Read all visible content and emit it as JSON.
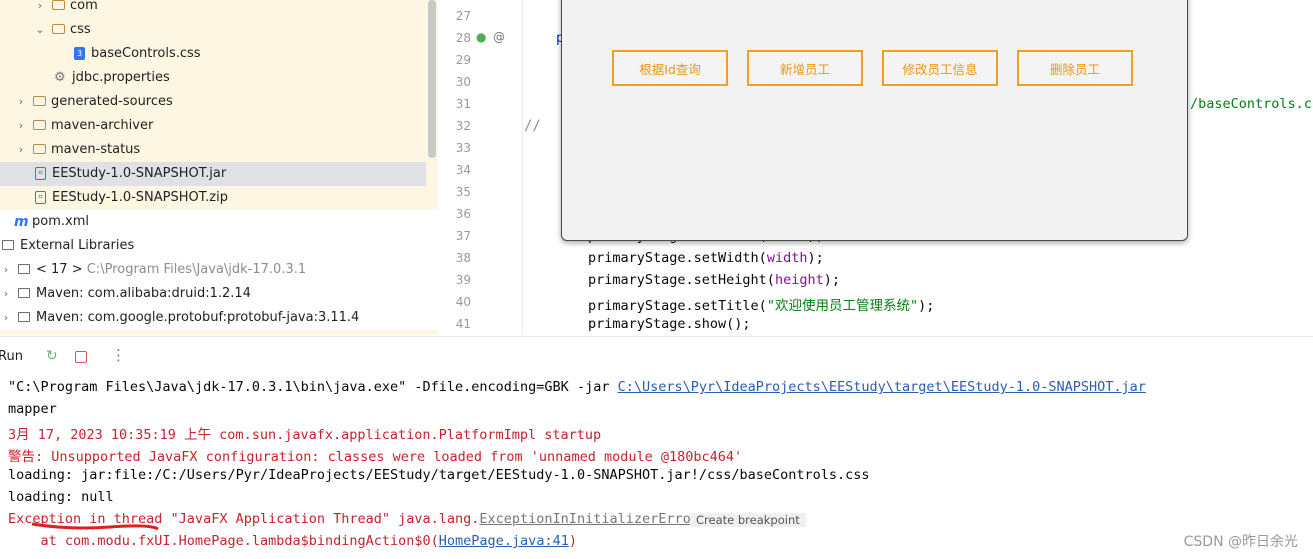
{
  "tree": {
    "items": [
      {
        "label": "com",
        "kind": "folder",
        "chev": "›"
      },
      {
        "label": "css",
        "kind": "folder",
        "chev": "⌄"
      },
      {
        "label": "baseControls.css",
        "kind": "css"
      },
      {
        "label": "jdbc.properties",
        "kind": "gear"
      },
      {
        "label": "generated-sources",
        "kind": "folder",
        "chev": "›"
      },
      {
        "label": "maven-archiver",
        "kind": "folder",
        "chev": "›"
      },
      {
        "label": "maven-status",
        "kind": "folder",
        "chev": "›"
      },
      {
        "label": "EEStudy-1.0-SNAPSHOT.jar",
        "kind": "archive"
      },
      {
        "label": "EEStudy-1.0-SNAPSHOT.zip",
        "kind": "archive"
      },
      {
        "label": "pom.xml",
        "kind": "maven"
      },
      {
        "label": "External Libraries",
        "kind": "lib"
      },
      {
        "label": "< 17 >",
        "extra": "C:\\Program Files\\Java\\jdk-17.0.3.1",
        "kind": "lib"
      },
      {
        "label": "Maven: com.alibaba:druid:1.2.14",
        "kind": "lib"
      },
      {
        "label": "Maven: com.google.protobuf:protobuf-java:3.11.4",
        "kind": "lib"
      }
    ]
  },
  "editor": {
    "line_numbers": [
      "27",
      "28",
      "29",
      "30",
      "31",
      "32",
      "33",
      "34",
      "35",
      "36",
      "37",
      "38",
      "39",
      "40",
      "41"
    ],
    "comment": "//",
    "left_fragment": "p",
    "path_fragment": "/baseControls.cs",
    "code": [
      {
        "pre": "primaryStage.setScene(",
        "arg": "scene",
        "post": ");"
      },
      {
        "pre": "primaryStage.setWidth(",
        "arg": "width",
        "post": ");"
      },
      {
        "pre": "primaryStage.setHeight(",
        "arg": "height",
        "post": ");"
      },
      {
        "pre": "primaryStage.setTitle(",
        "str": "\"欢迎使用员工管理系统\"",
        "post": ");"
      },
      {
        "pre": "primaryStage.show();"
      }
    ]
  },
  "fx_window": {
    "buttons": [
      "根据Id查询",
      "新增员工",
      "修改员工信息",
      "删除员工"
    ]
  },
  "run": {
    "label": "Run",
    "rerun_icon": "rerun-icon",
    "stop_icon": "stop-icon",
    "more_icon": "more-icon"
  },
  "console": {
    "line1_cmd": "\"C:\\Program Files\\Java\\jdk-17.0.3.1\\bin\\java.exe\" -Dfile.encoding=GBK -jar ",
    "line1_link": "C:\\Users\\Pyr\\IdeaProjects\\EEStudy\\target\\EEStudy-1.0-SNAPSHOT.jar",
    "line2": "mapper",
    "line3": "3月 17, 2023 10:35:19 上午 com.sun.javafx.application.PlatformImpl startup",
    "line4_prefix": "警告: ",
    "line4_msg": "Unsupported JavaFX configuration: classes were loaded from 'unnamed module @180bc464'",
    "line5": "loading: jar:file:/C:/Users/Pyr/IdeaProjects/EEStudy/target/EEStudy-1.0-SNAPSHOT.jar!/css/baseControls.css",
    "line6": "loading: null",
    "line7_pre": "Exception in thread \"JavaFX Application Thread\" java.lang.",
    "line7_link": "ExceptionInInitializerError",
    "breakpoint": "Create breakpoint",
    "line8_pre": "    at com.modu.fxUI.HomePage.lambda$bindingAction$0(",
    "line8_link": "HomePage.java:41",
    "line8_post": ")"
  },
  "watermark": "CSDN @昨日余光"
}
